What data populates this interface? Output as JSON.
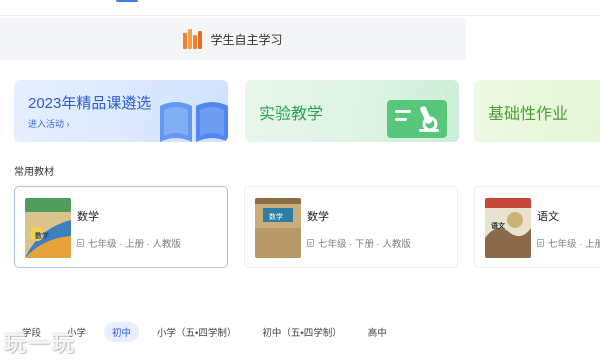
{
  "study_bar": {
    "label": "学生自主学习"
  },
  "banners": [
    {
      "title": "2023年精品课遴选",
      "sub": "进入活动 ›"
    },
    {
      "title": "实验教学"
    },
    {
      "title": "基础性作业"
    }
  ],
  "section_title": "常用教材",
  "textbooks": [
    {
      "subject": "数学",
      "meta": "七年级 · 上册 · 人教版",
      "cover_text": "数学"
    },
    {
      "subject": "数学",
      "meta": "七年级 · 下册 · 人教版",
      "cover_text": "数学"
    },
    {
      "subject": "语文",
      "meta": "七年级 · 上册",
      "cover_text": "语文"
    }
  ],
  "grade_tabs": [
    "学段",
    "小学",
    "初中",
    "小学（五•四学制）",
    "初中（五•四学制）",
    "高中"
  ],
  "active_grade_tab": 2,
  "watermark": "玩一玩",
  "colors": {
    "accent": "#3d7bf5",
    "banner1_text": "#2f5bd3",
    "banner2_text": "#27a34f",
    "banner3_text": "#46a12e"
  }
}
